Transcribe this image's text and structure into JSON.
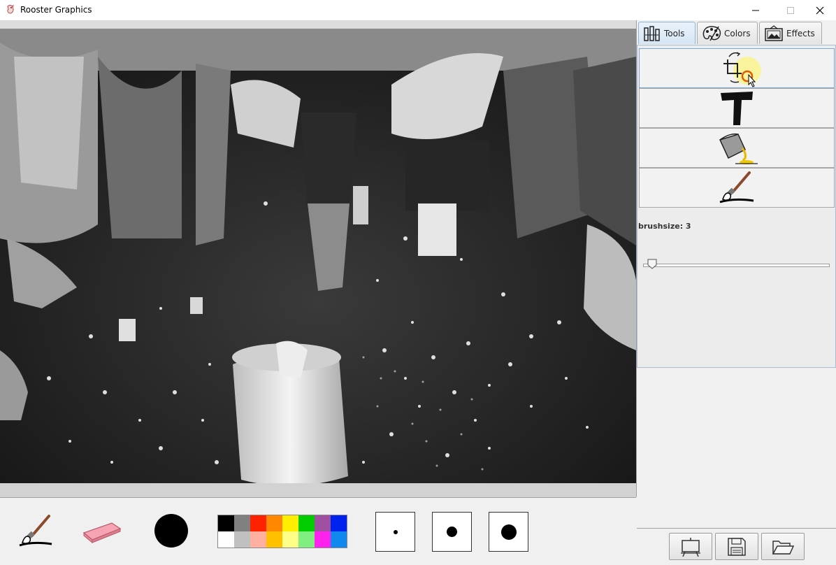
{
  "window": {
    "title": "Rooster Graphics"
  },
  "tabs": [
    {
      "label": "Tools",
      "icon": "tools-icon",
      "active": true
    },
    {
      "label": "Colors",
      "icon": "palette-icon",
      "active": false
    },
    {
      "label": "Effects",
      "icon": "picture-icon",
      "active": false
    }
  ],
  "tool_buttons": [
    {
      "icon": "crop-rotate-icon"
    },
    {
      "icon": "text-tool-icon"
    },
    {
      "icon": "paint-bucket-icon"
    },
    {
      "icon": "paintbrush-icon"
    }
  ],
  "brush": {
    "label": "brushsize: 3",
    "size": 3,
    "slider_fraction": 0.04
  },
  "palette": {
    "row1": [
      "#000000",
      "#808080",
      "#ff2200",
      "#ff8800",
      "#ffee00",
      "#00cc00",
      "#a050a0",
      "#0022ee"
    ],
    "row2": [
      "#ffffff",
      "#c0c0c0",
      "#ffb0a0",
      "#ffc000",
      "#ffff88",
      "#80ee80",
      "#ff22ee",
      "#1188ee"
    ]
  },
  "brush_sizes": [
    "small-dot",
    "medium-dot",
    "large-dot"
  ],
  "bottom_tools": [
    "paintbrush-icon",
    "eraser-icon",
    "current-color-black"
  ],
  "actions": [
    "new-canvas-icon",
    "save-icon",
    "open-folder-icon"
  ]
}
